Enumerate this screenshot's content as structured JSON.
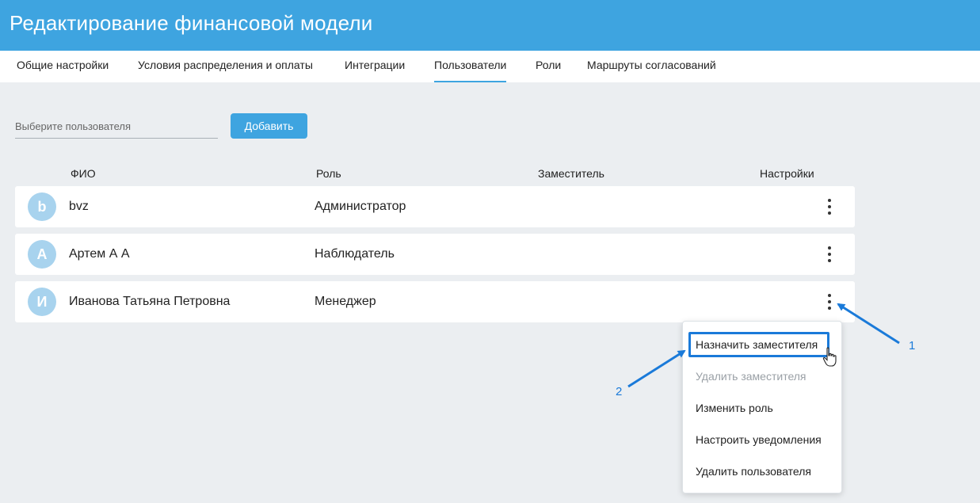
{
  "header": {
    "title": "Редактирование финансовой модели"
  },
  "tabs": [
    {
      "label": "Общие настройки",
      "active": false
    },
    {
      "label": "Условия распределения и оплаты",
      "active": false
    },
    {
      "label": "Интеграции",
      "active": false
    },
    {
      "label": "Пользователи",
      "active": true
    },
    {
      "label": "Роли",
      "active": false
    },
    {
      "label": "Маршруты согласований",
      "active": false
    }
  ],
  "toolbar": {
    "user_placeholder": "Выберите пользователя",
    "add_label": "Добавить"
  },
  "table": {
    "columns": [
      "ФИО",
      "Роль",
      "Заместитель",
      "Настройки"
    ],
    "rows": [
      {
        "avatar": "b",
        "name": "bvz",
        "role": "Администратор",
        "deputy": ""
      },
      {
        "avatar": "А",
        "name": "Артем А А",
        "role": "Наблюдатель",
        "deputy": ""
      },
      {
        "avatar": "И",
        "name": "Иванова Татьяна Петровна",
        "role": "Менеджер",
        "deputy": ""
      }
    ]
  },
  "context_menu": {
    "items": [
      {
        "label": "Назначить заместителя",
        "disabled": false,
        "highlighted": true
      },
      {
        "label": "Удалить заместителя",
        "disabled": true
      },
      {
        "label": "Изменить роль",
        "disabled": false
      },
      {
        "label": "Настроить уведомления",
        "disabled": false
      },
      {
        "label": "Удалить пользователя",
        "disabled": false
      }
    ]
  },
  "annotations": {
    "step1": "1",
    "step2": "2"
  },
  "colors": {
    "header": "#3ea4e0",
    "accent": "#3ea4e0",
    "annotation": "#1a7ad9",
    "avatar": "#a8d3ee",
    "background": "#ebeef1"
  },
  "icons": [
    "kebab-menu-icon",
    "pointer-cursor-icon",
    "arrow-annotation-icon"
  ]
}
